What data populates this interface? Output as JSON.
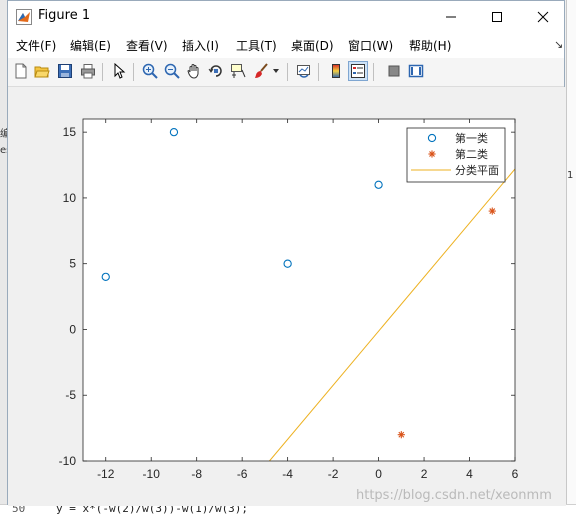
{
  "window": {
    "title": "Figure 1"
  },
  "menu": {
    "items": [
      {
        "label": "文件(F)",
        "name": "menu-file"
      },
      {
        "label": "编辑(E)",
        "name": "menu-edit"
      },
      {
        "label": "查看(V)",
        "name": "menu-view"
      },
      {
        "label": "插入(I)",
        "name": "menu-insert"
      },
      {
        "label": "工具(T)",
        "name": "menu-tools"
      },
      {
        "label": "桌面(D)",
        "name": "menu-desktop"
      },
      {
        "label": "窗口(W)",
        "name": "menu-window"
      },
      {
        "label": "帮助(H)",
        "name": "menu-help"
      }
    ],
    "overflow_glyph": "↘"
  },
  "toolbar": {
    "icons": [
      "new-figure-icon",
      "open-file-icon",
      "save-icon",
      "print-icon",
      "pointer-icon",
      "zoom-in-icon",
      "zoom-out-icon",
      "pan-icon",
      "rotate-3d-icon",
      "data-cursor-icon",
      "brush-icon",
      "brush-dropdown-icon",
      "link-plot-icon",
      "colorbar-icon",
      "legend-icon",
      "hide-plot-tools-icon",
      "show-plot-tools-icon"
    ]
  },
  "background": {
    "left_tab_glyphs": [
      "编",
      "es"
    ],
    "right_tab_glyph": "1",
    "bottom_line_number": "50",
    "bottom_code": "y = x*(-w(2)/w(3))-w(1)/w(3);"
  },
  "watermark": "https://blog.csdn.net/xeonmm",
  "colors": {
    "class1": "#0072BD",
    "class2": "#D95319",
    "plane": "#EDB120"
  },
  "chart_data": {
    "type": "scatter",
    "title": "",
    "xlabel": "",
    "ylabel": "",
    "xlim": [
      -13,
      6
    ],
    "ylim": [
      -10,
      16
    ],
    "xticks": [
      -12,
      -10,
      -8,
      -6,
      -4,
      -2,
      0,
      2,
      4,
      6
    ],
    "yticks": [
      -10,
      -5,
      0,
      5,
      10,
      15
    ],
    "grid": false,
    "legend_position": "top-right",
    "series": [
      {
        "name": "第一类",
        "marker": "o",
        "points": [
          [
            -12,
            4
          ],
          [
            -9,
            15
          ],
          [
            -4,
            5
          ],
          [
            0,
            11
          ]
        ]
      },
      {
        "name": "第二类",
        "marker": "*",
        "points": [
          [
            5,
            9
          ],
          [
            1,
            -8
          ]
        ]
      },
      {
        "name": "分类平面",
        "marker": "line",
        "points": [
          [
            -4.8,
            -10
          ],
          [
            6,
            12.2
          ]
        ]
      }
    ]
  }
}
